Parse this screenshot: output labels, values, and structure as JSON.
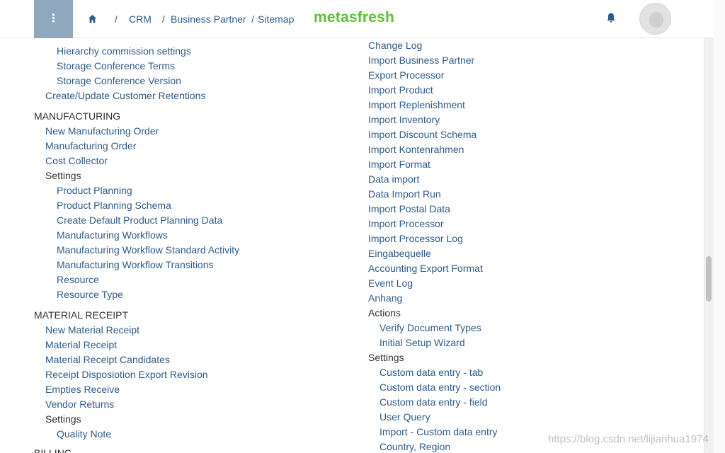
{
  "header": {
    "menu_icon": "vertical-dots-icon",
    "home_icon": "home-icon",
    "breadcrumbs": [
      {
        "sep": "/",
        "label": "CRM"
      },
      {
        "sep": "/",
        "label": "Business Partner"
      },
      {
        "sep": "/",
        "label": "Sitemap"
      }
    ],
    "logo": "metasfresh",
    "bell_icon": "bell-icon",
    "avatar_icon": "avatar-icon"
  },
  "colors": {
    "link": "#2d5b8a",
    "logo": "#5cc234",
    "menu_button": "#8fa8bd"
  },
  "left_column": [
    {
      "label": "Hierarchy commission settings",
      "kind": "link"
    },
    {
      "label": "Storage Conference Terms",
      "kind": "link"
    },
    {
      "label": "Storage Conference Version",
      "kind": "link"
    },
    {
      "label": "Create/Update Customer Retentions",
      "kind": "link"
    },
    {
      "label": "MANUFACTURING",
      "kind": "section"
    },
    {
      "label": "New Manufacturing Order",
      "kind": "link"
    },
    {
      "label": "Manufacturing Order",
      "kind": "link"
    },
    {
      "label": "Cost Collector",
      "kind": "link"
    },
    {
      "label": "Settings",
      "kind": "group"
    },
    {
      "label": "Product Planning",
      "kind": "link"
    },
    {
      "label": "Product Planning Schema",
      "kind": "link"
    },
    {
      "label": "Create Default Product Planning Data",
      "kind": "link"
    },
    {
      "label": "Manufacturing Workflows",
      "kind": "link"
    },
    {
      "label": "Manufacturing Workflow Standard Activity",
      "kind": "link"
    },
    {
      "label": "Manufacturing Workflow Transitions",
      "kind": "link"
    },
    {
      "label": "Resource",
      "kind": "link"
    },
    {
      "label": "Resource Type",
      "kind": "link"
    },
    {
      "label": "MATERIAL RECEIPT",
      "kind": "section"
    },
    {
      "label": "New Material Receipt",
      "kind": "link"
    },
    {
      "label": "Material Receipt",
      "kind": "link"
    },
    {
      "label": "Material Receipt Candidates",
      "kind": "link"
    },
    {
      "label": "Receipt Disposiotion Export Revision",
      "kind": "link"
    },
    {
      "label": "Empties Receive",
      "kind": "link"
    },
    {
      "label": "Vendor Returns",
      "kind": "link"
    },
    {
      "label": "Settings",
      "kind": "group"
    },
    {
      "label": "Quality Note",
      "kind": "link"
    },
    {
      "label": "BILLING",
      "kind": "section"
    }
  ],
  "right_column": [
    {
      "label": "Change Log",
      "kind": "link"
    },
    {
      "label": "Import Business Partner",
      "kind": "link"
    },
    {
      "label": "Export Processor",
      "kind": "link"
    },
    {
      "label": "Import Product",
      "kind": "link"
    },
    {
      "label": "Import Replenishment",
      "kind": "link"
    },
    {
      "label": "Import Inventory",
      "kind": "link"
    },
    {
      "label": "Import Discount Schema",
      "kind": "link"
    },
    {
      "label": "Import Kontenrahmen",
      "kind": "link"
    },
    {
      "label": "Import Format",
      "kind": "link"
    },
    {
      "label": "Data import",
      "kind": "link"
    },
    {
      "label": "Data Import Run",
      "kind": "link"
    },
    {
      "label": "Import Postal Data",
      "kind": "link"
    },
    {
      "label": "Import Processor",
      "kind": "link"
    },
    {
      "label": "Import Processor Log",
      "kind": "link"
    },
    {
      "label": "Eingabequelle",
      "kind": "link"
    },
    {
      "label": "Accounting Export Format",
      "kind": "link"
    },
    {
      "label": "Event Log",
      "kind": "link"
    },
    {
      "label": "Anhang",
      "kind": "link"
    },
    {
      "label": "Actions",
      "kind": "group"
    },
    {
      "label": "Verify Document Types",
      "kind": "link"
    },
    {
      "label": "Initial Setup Wizard",
      "kind": "link"
    },
    {
      "label": "Settings",
      "kind": "group"
    },
    {
      "label": "Custom data entry - tab",
      "kind": "link"
    },
    {
      "label": "Custom data entry - section",
      "kind": "link"
    },
    {
      "label": "Custom data entry - field",
      "kind": "link"
    },
    {
      "label": "User Query",
      "kind": "link"
    },
    {
      "label": "Import - Custom data entry",
      "kind": "link"
    },
    {
      "label": "Country, Region",
      "kind": "link"
    }
  ],
  "watermark": "https://blog.csdn.net/lijianhua1974"
}
